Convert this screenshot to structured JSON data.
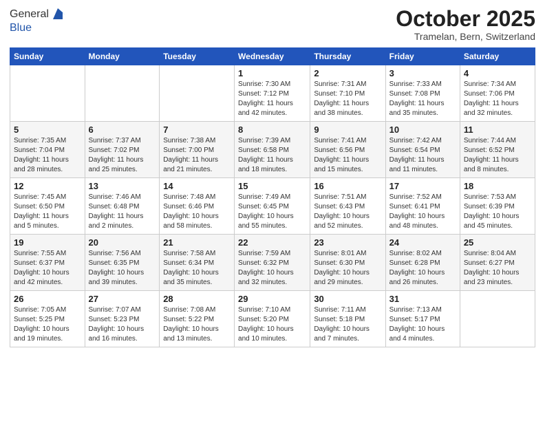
{
  "header": {
    "logo_line1": "General",
    "logo_line2": "Blue",
    "month": "October 2025",
    "location": "Tramelan, Bern, Switzerland"
  },
  "weekdays": [
    "Sunday",
    "Monday",
    "Tuesday",
    "Wednesday",
    "Thursday",
    "Friday",
    "Saturday"
  ],
  "weeks": [
    [
      {
        "day": "",
        "sunrise": "",
        "sunset": "",
        "daylight": ""
      },
      {
        "day": "",
        "sunrise": "",
        "sunset": "",
        "daylight": ""
      },
      {
        "day": "",
        "sunrise": "",
        "sunset": "",
        "daylight": ""
      },
      {
        "day": "1",
        "sunrise": "Sunrise: 7:30 AM",
        "sunset": "Sunset: 7:12 PM",
        "daylight": "Daylight: 11 hours and 42 minutes."
      },
      {
        "day": "2",
        "sunrise": "Sunrise: 7:31 AM",
        "sunset": "Sunset: 7:10 PM",
        "daylight": "Daylight: 11 hours and 38 minutes."
      },
      {
        "day": "3",
        "sunrise": "Sunrise: 7:33 AM",
        "sunset": "Sunset: 7:08 PM",
        "daylight": "Daylight: 11 hours and 35 minutes."
      },
      {
        "day": "4",
        "sunrise": "Sunrise: 7:34 AM",
        "sunset": "Sunset: 7:06 PM",
        "daylight": "Daylight: 11 hours and 32 minutes."
      }
    ],
    [
      {
        "day": "5",
        "sunrise": "Sunrise: 7:35 AM",
        "sunset": "Sunset: 7:04 PM",
        "daylight": "Daylight: 11 hours and 28 minutes."
      },
      {
        "day": "6",
        "sunrise": "Sunrise: 7:37 AM",
        "sunset": "Sunset: 7:02 PM",
        "daylight": "Daylight: 11 hours and 25 minutes."
      },
      {
        "day": "7",
        "sunrise": "Sunrise: 7:38 AM",
        "sunset": "Sunset: 7:00 PM",
        "daylight": "Daylight: 11 hours and 21 minutes."
      },
      {
        "day": "8",
        "sunrise": "Sunrise: 7:39 AM",
        "sunset": "Sunset: 6:58 PM",
        "daylight": "Daylight: 11 hours and 18 minutes."
      },
      {
        "day": "9",
        "sunrise": "Sunrise: 7:41 AM",
        "sunset": "Sunset: 6:56 PM",
        "daylight": "Daylight: 11 hours and 15 minutes."
      },
      {
        "day": "10",
        "sunrise": "Sunrise: 7:42 AM",
        "sunset": "Sunset: 6:54 PM",
        "daylight": "Daylight: 11 hours and 11 minutes."
      },
      {
        "day": "11",
        "sunrise": "Sunrise: 7:44 AM",
        "sunset": "Sunset: 6:52 PM",
        "daylight": "Daylight: 11 hours and 8 minutes."
      }
    ],
    [
      {
        "day": "12",
        "sunrise": "Sunrise: 7:45 AM",
        "sunset": "Sunset: 6:50 PM",
        "daylight": "Daylight: 11 hours and 5 minutes."
      },
      {
        "day": "13",
        "sunrise": "Sunrise: 7:46 AM",
        "sunset": "Sunset: 6:48 PM",
        "daylight": "Daylight: 11 hours and 2 minutes."
      },
      {
        "day": "14",
        "sunrise": "Sunrise: 7:48 AM",
        "sunset": "Sunset: 6:46 PM",
        "daylight": "Daylight: 10 hours and 58 minutes."
      },
      {
        "day": "15",
        "sunrise": "Sunrise: 7:49 AM",
        "sunset": "Sunset: 6:45 PM",
        "daylight": "Daylight: 10 hours and 55 minutes."
      },
      {
        "day": "16",
        "sunrise": "Sunrise: 7:51 AM",
        "sunset": "Sunset: 6:43 PM",
        "daylight": "Daylight: 10 hours and 52 minutes."
      },
      {
        "day": "17",
        "sunrise": "Sunrise: 7:52 AM",
        "sunset": "Sunset: 6:41 PM",
        "daylight": "Daylight: 10 hours and 48 minutes."
      },
      {
        "day": "18",
        "sunrise": "Sunrise: 7:53 AM",
        "sunset": "Sunset: 6:39 PM",
        "daylight": "Daylight: 10 hours and 45 minutes."
      }
    ],
    [
      {
        "day": "19",
        "sunrise": "Sunrise: 7:55 AM",
        "sunset": "Sunset: 6:37 PM",
        "daylight": "Daylight: 10 hours and 42 minutes."
      },
      {
        "day": "20",
        "sunrise": "Sunrise: 7:56 AM",
        "sunset": "Sunset: 6:35 PM",
        "daylight": "Daylight: 10 hours and 39 minutes."
      },
      {
        "day": "21",
        "sunrise": "Sunrise: 7:58 AM",
        "sunset": "Sunset: 6:34 PM",
        "daylight": "Daylight: 10 hours and 35 minutes."
      },
      {
        "day": "22",
        "sunrise": "Sunrise: 7:59 AM",
        "sunset": "Sunset: 6:32 PM",
        "daylight": "Daylight: 10 hours and 32 minutes."
      },
      {
        "day": "23",
        "sunrise": "Sunrise: 8:01 AM",
        "sunset": "Sunset: 6:30 PM",
        "daylight": "Daylight: 10 hours and 29 minutes."
      },
      {
        "day": "24",
        "sunrise": "Sunrise: 8:02 AM",
        "sunset": "Sunset: 6:28 PM",
        "daylight": "Daylight: 10 hours and 26 minutes."
      },
      {
        "day": "25",
        "sunrise": "Sunrise: 8:04 AM",
        "sunset": "Sunset: 6:27 PM",
        "daylight": "Daylight: 10 hours and 23 minutes."
      }
    ],
    [
      {
        "day": "26",
        "sunrise": "Sunrise: 7:05 AM",
        "sunset": "Sunset: 5:25 PM",
        "daylight": "Daylight: 10 hours and 19 minutes."
      },
      {
        "day": "27",
        "sunrise": "Sunrise: 7:07 AM",
        "sunset": "Sunset: 5:23 PM",
        "daylight": "Daylight: 10 hours and 16 minutes."
      },
      {
        "day": "28",
        "sunrise": "Sunrise: 7:08 AM",
        "sunset": "Sunset: 5:22 PM",
        "daylight": "Daylight: 10 hours and 13 minutes."
      },
      {
        "day": "29",
        "sunrise": "Sunrise: 7:10 AM",
        "sunset": "Sunset: 5:20 PM",
        "daylight": "Daylight: 10 hours and 10 minutes."
      },
      {
        "day": "30",
        "sunrise": "Sunrise: 7:11 AM",
        "sunset": "Sunset: 5:18 PM",
        "daylight": "Daylight: 10 hours and 7 minutes."
      },
      {
        "day": "31",
        "sunrise": "Sunrise: 7:13 AM",
        "sunset": "Sunset: 5:17 PM",
        "daylight": "Daylight: 10 hours and 4 minutes."
      },
      {
        "day": "",
        "sunrise": "",
        "sunset": "",
        "daylight": ""
      }
    ]
  ]
}
